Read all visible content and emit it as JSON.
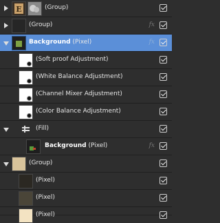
{
  "layers": [
    {
      "label": "(Group)",
      "visible": true
    },
    {
      "label": "(Group)",
      "fx": "fx",
      "visible": true
    },
    {
      "name": "Background",
      "type": "(Pixel)",
      "fx": "fx",
      "visible": true,
      "selected": true
    },
    {
      "label": "(Soft proof Adjustment)",
      "visible": true
    },
    {
      "label": "(White Balance Adjustment)",
      "visible": true
    },
    {
      "label": "(Channel Mixer Adjustment)",
      "visible": true
    },
    {
      "label": "(Color Balance Adjustment)",
      "visible": true
    },
    {
      "label": "(Fill)",
      "visible": true
    },
    {
      "name": "Background",
      "type": "(Pixel)",
      "fx": "fx",
      "visible": true
    },
    {
      "label": "(Group)",
      "visible": true
    },
    {
      "label": "(Pixel)",
      "visible": true
    },
    {
      "label": "(Pixel)",
      "visible": true
    },
    {
      "label": "(Pixel)",
      "visible": true
    }
  ],
  "colors": {
    "selected_row": "#5b8fd8",
    "panel_bg": "#2e2e2e"
  }
}
